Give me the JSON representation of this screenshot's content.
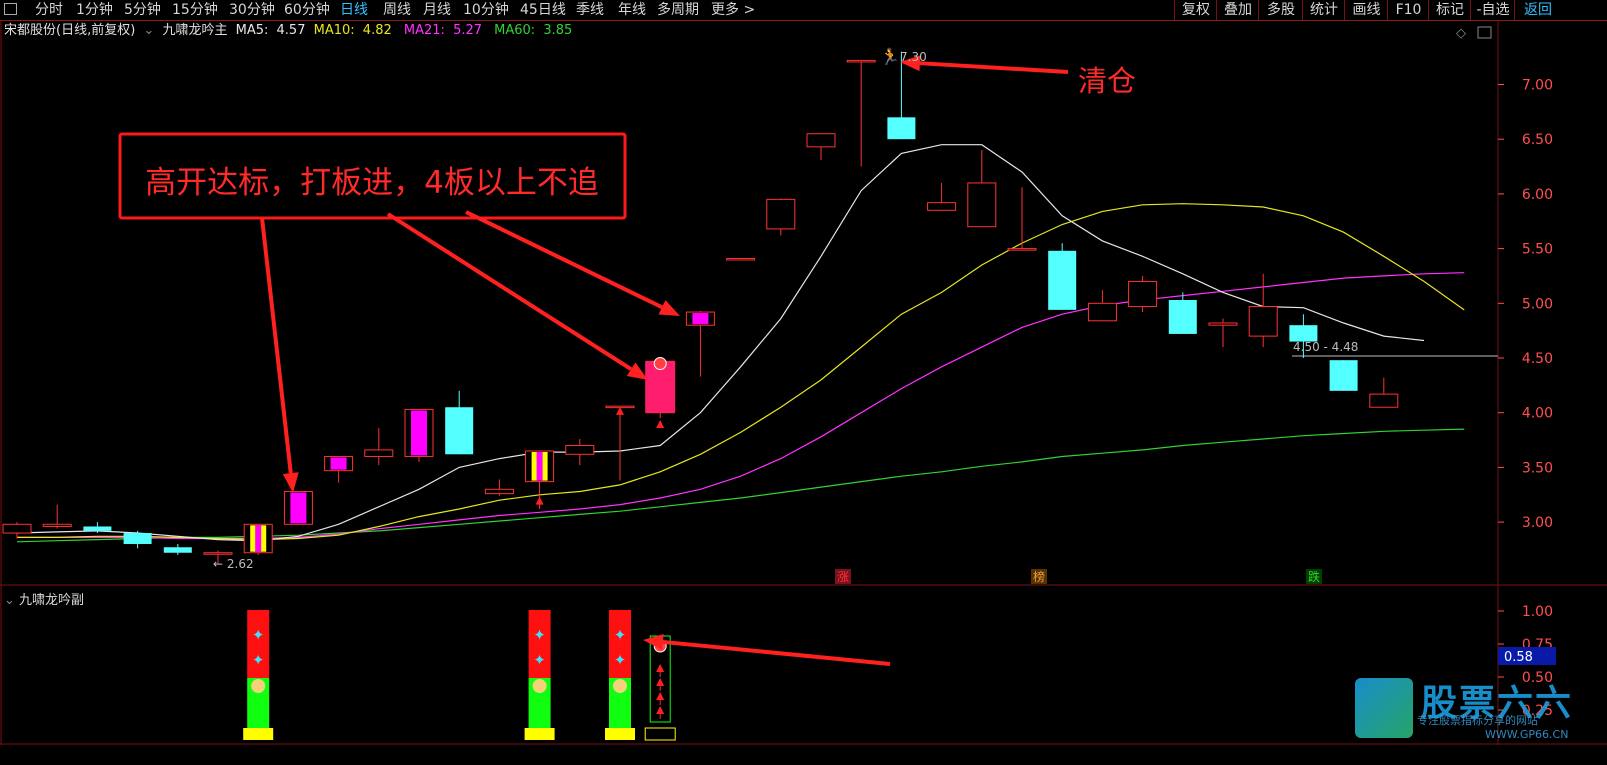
{
  "toolbar": {
    "left": [
      "分时",
      "1分钟",
      "5分钟",
      "15分钟",
      "30分钟",
      "60分钟",
      "日线",
      "周线",
      "月线",
      "10分钟",
      "45日线",
      "季线",
      "年线",
      "多周期",
      "更多 >"
    ],
    "active": "日线",
    "right": [
      "复权",
      "叠加",
      "多股",
      "统计",
      "画线",
      "F10",
      "标记",
      "-自选",
      "返回"
    ],
    "selected_right": "返回"
  },
  "info": {
    "stock": "宋都股份(日线,前复权)",
    "indicator": "九啸龙吟主",
    "ma5_label": "MA5:",
    "ma5": "4.57",
    "ma10_label": "MA10:",
    "ma10": "4.82",
    "ma21_label": "MA21:",
    "ma21": "5.27",
    "ma60_label": "MA60:",
    "ma60": "3.85"
  },
  "sub_indicator": "九啸龙吟副",
  "annotations": {
    "box_text": "高开达标，打板进，4板以上不追",
    "clear_text": "清仓",
    "high_label": "7.30",
    "low_label": "2.62",
    "price_line_label": "4.50 - 4.48",
    "tag_zhang": "涨",
    "tag_bang": "榜",
    "tag_die": "跌",
    "sub_value": "0.58"
  },
  "watermark": {
    "brand": "股票六六",
    "slogan": "专注股票指标分享的网站",
    "url": "WWW.GP66.CN"
  },
  "colors": {
    "up": "#ff3232",
    "down": "#54ffff",
    "ma5": "#e6e6e6",
    "ma10": "#e6e61e",
    "ma21": "#ff32ff",
    "ma60": "#32d232",
    "grid": "#7a1010",
    "axis_text": "#ff5050",
    "arrow": "#ff2020"
  },
  "chart_data": {
    "type": "candlestick",
    "y_axis_ticks": [
      "7.00",
      "6.50",
      "6.00",
      "5.50",
      "5.00",
      "4.50",
      "4.00",
      "3.50",
      "3.00"
    ],
    "sub_axis_ticks": [
      "1.00",
      "0.75",
      "0.50",
      "0.25"
    ],
    "candles": [
      {
        "o": 2.9,
        "h": 3.0,
        "l": 2.85,
        "c": 2.98
      },
      {
        "o": 2.96,
        "h": 3.16,
        "l": 2.94,
        "c": 2.98
      },
      {
        "o": 2.96,
        "h": 3.0,
        "l": 2.9,
        "c": 2.92
      },
      {
        "o": 2.9,
        "h": 2.92,
        "l": 2.76,
        "c": 2.8
      },
      {
        "o": 2.77,
        "h": 2.8,
        "l": 2.7,
        "c": 2.72
      },
      {
        "o": 2.72,
        "h": 2.74,
        "l": 2.62,
        "c": 2.72
      },
      {
        "o": 2.72,
        "h": 2.98,
        "l": 2.7,
        "c": 2.98
      },
      {
        "o": 2.98,
        "h": 3.28,
        "l": 2.98,
        "c": 3.28
      },
      {
        "o": 3.47,
        "h": 3.6,
        "l": 3.36,
        "c": 3.6
      },
      {
        "o": 3.6,
        "h": 3.86,
        "l": 3.52,
        "c": 3.66
      },
      {
        "o": 3.6,
        "h": 4.03,
        "l": 3.55,
        "c": 4.03
      },
      {
        "o": 4.05,
        "h": 4.2,
        "l": 3.62,
        "c": 3.62
      },
      {
        "o": 3.26,
        "h": 3.39,
        "l": 3.24,
        "c": 3.3
      },
      {
        "o": 3.37,
        "h": 3.65,
        "l": 3.12,
        "c": 3.65
      },
      {
        "o": 3.62,
        "h": 3.76,
        "l": 3.52,
        "c": 3.7
      },
      {
        "o": 4.06,
        "h": 4.06,
        "l": 3.38,
        "c": 4.06
      },
      {
        "o": 4.0,
        "h": 4.5,
        "l": 3.95,
        "c": 4.47
      },
      {
        "o": 4.8,
        "h": 4.93,
        "l": 4.33,
        "c": 4.92
      },
      {
        "o": 5.41,
        "h": 5.41,
        "l": 5.41,
        "c": 5.41
      },
      {
        "o": 5.68,
        "h": 5.96,
        "l": 5.62,
        "c": 5.95
      },
      {
        "o": 6.43,
        "h": 6.55,
        "l": 6.31,
        "c": 6.55
      },
      {
        "o": 7.22,
        "h": 7.22,
        "l": 6.25,
        "c": 7.22
      },
      {
        "o": 6.7,
        "h": 7.3,
        "l": 6.5,
        "c": 6.5
      },
      {
        "o": 5.85,
        "h": 6.1,
        "l": 5.85,
        "c": 5.92
      },
      {
        "o": 5.7,
        "h": 6.4,
        "l": 5.7,
        "c": 6.1
      },
      {
        "o": 5.5,
        "h": 6.06,
        "l": 5.5,
        "c": 5.5
      },
      {
        "o": 5.48,
        "h": 5.55,
        "l": 4.94,
        "c": 4.94
      },
      {
        "o": 4.84,
        "h": 5.12,
        "l": 4.84,
        "c": 5.0
      },
      {
        "o": 4.97,
        "h": 5.25,
        "l": 4.92,
        "c": 5.2
      },
      {
        "o": 5.03,
        "h": 5.1,
        "l": 4.72,
        "c": 4.72
      },
      {
        "o": 4.8,
        "h": 4.86,
        "l": 4.6,
        "c": 4.82
      },
      {
        "o": 4.7,
        "h": 5.27,
        "l": 4.6,
        "c": 4.97
      },
      {
        "o": 4.8,
        "h": 4.9,
        "l": 4.5,
        "c": 4.65
      },
      {
        "o": 4.48,
        "h": 4.48,
        "l": 4.2,
        "c": 4.2
      },
      {
        "o": 4.05,
        "h": 4.32,
        "l": 4.05,
        "c": 4.17
      }
    ],
    "ma5": [
      2.9,
      2.91,
      2.92,
      2.9,
      2.87,
      2.84,
      2.83,
      2.87,
      2.98,
      3.14,
      3.3,
      3.5,
      3.58,
      3.64,
      3.64,
      3.65,
      3.7,
      4.0,
      4.42,
      4.86,
      5.43,
      6.03,
      6.37,
      6.45,
      6.45,
      6.2,
      5.8,
      5.57,
      5.43,
      5.27,
      5.1,
      4.97,
      4.96,
      4.82,
      4.7,
      4.66
    ],
    "ma10": [
      2.86,
      2.86,
      2.87,
      2.87,
      2.86,
      2.85,
      2.84,
      2.85,
      2.88,
      2.96,
      3.05,
      3.12,
      3.2,
      3.25,
      3.28,
      3.34,
      3.46,
      3.62,
      3.82,
      4.05,
      4.3,
      4.6,
      4.9,
      5.1,
      5.35,
      5.55,
      5.72,
      5.84,
      5.9,
      5.91,
      5.9,
      5.88,
      5.8,
      5.65,
      5.43,
      5.2,
      4.94
    ],
    "ma21": [
      2.86,
      2.86,
      2.86,
      2.86,
      2.85,
      2.85,
      2.85,
      2.86,
      2.89,
      2.94,
      2.98,
      3.02,
      3.06,
      3.09,
      3.12,
      3.16,
      3.22,
      3.3,
      3.42,
      3.58,
      3.78,
      4.0,
      4.22,
      4.42,
      4.6,
      4.78,
      4.9,
      4.98,
      5.03,
      5.07,
      5.11,
      5.15,
      5.19,
      5.23,
      5.25,
      5.27,
      5.28
    ],
    "ma60": [
      2.82,
      2.83,
      2.84,
      2.85,
      2.86,
      2.86,
      2.87,
      2.88,
      2.9,
      2.92,
      2.95,
      2.98,
      3.01,
      3.04,
      3.07,
      3.1,
      3.14,
      3.18,
      3.22,
      3.27,
      3.32,
      3.37,
      3.42,
      3.46,
      3.51,
      3.55,
      3.6,
      3.63,
      3.66,
      3.7,
      3.73,
      3.76,
      3.79,
      3.81,
      3.83,
      3.84,
      3.85
    ]
  }
}
